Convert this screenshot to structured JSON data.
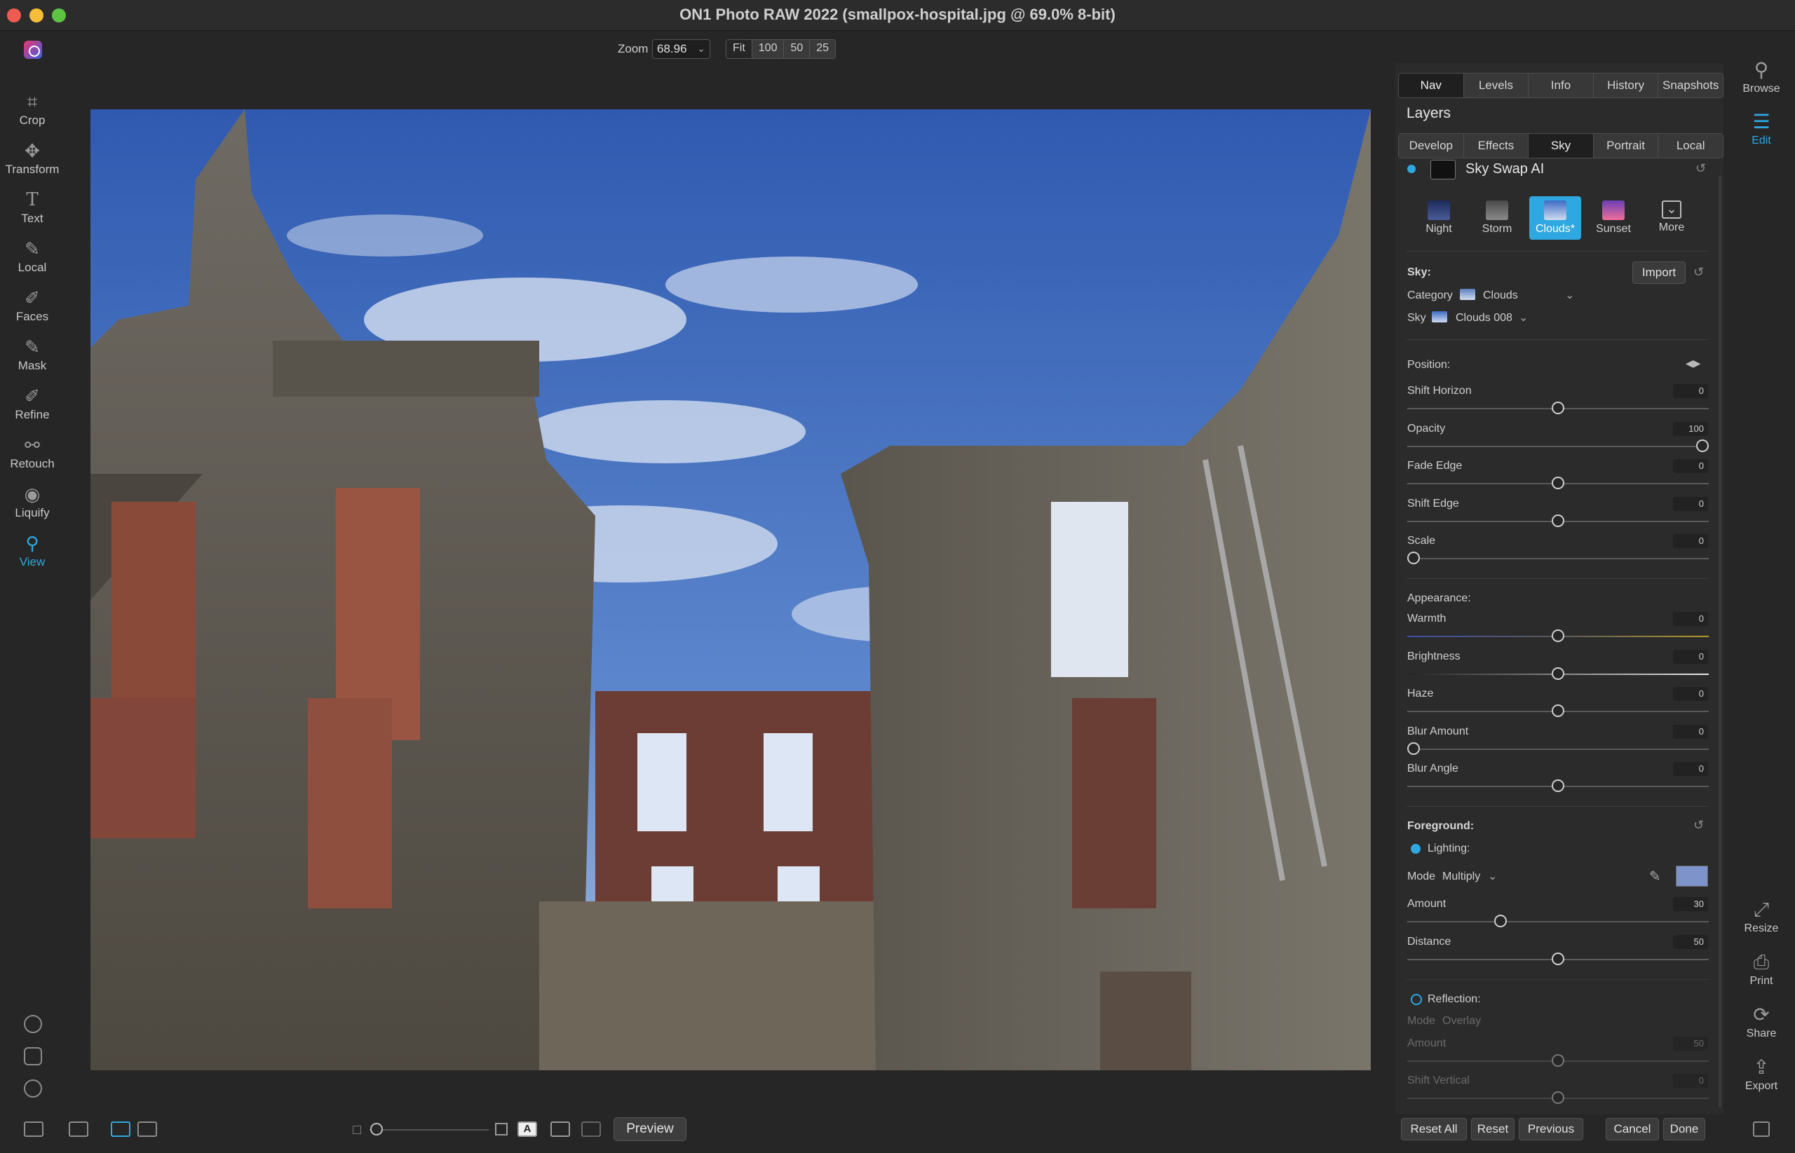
{
  "window": {
    "title": "ON1 Photo RAW 2022 (smallpox-hospital.jpg @ 69.0% 8-bit)"
  },
  "zoom": {
    "label": "Zoom",
    "value": "68.96",
    "presets": [
      "Fit",
      "100",
      "50",
      "25"
    ]
  },
  "left_tools": [
    {
      "label": "Crop",
      "icon": "crop-icon"
    },
    {
      "label": "Transform",
      "icon": "transform-icon"
    },
    {
      "label": "Text",
      "icon": "text-icon"
    },
    {
      "label": "Local",
      "icon": "local-brush-icon"
    },
    {
      "label": "Faces",
      "icon": "faces-icon"
    },
    {
      "label": "Mask",
      "icon": "mask-icon"
    },
    {
      "label": "Refine",
      "icon": "refine-icon"
    },
    {
      "label": "Retouch",
      "icon": "retouch-icon"
    },
    {
      "label": "Liquify",
      "icon": "liquify-icon"
    },
    {
      "label": "View",
      "icon": "view-icon",
      "active": true
    }
  ],
  "right_tools": {
    "browse": "Browse",
    "edit": "Edit",
    "resize": "Resize",
    "print": "Print",
    "share": "Share",
    "export": "Export"
  },
  "panel": {
    "top_tabs": [
      "Nav",
      "Levels",
      "Info",
      "History",
      "Snapshots"
    ],
    "active_top_tab": "Nav",
    "layers_title": "Layers",
    "module_tabs": [
      "Develop",
      "Effects",
      "Sky",
      "Portrait",
      "Local"
    ],
    "active_module_tab": "Sky",
    "filter_name": "Sky Swap AI",
    "sky_presets": [
      "Night",
      "Storm",
      "Clouds*",
      "Sunset",
      "More"
    ],
    "active_preset": "Clouds*",
    "sky_section": {
      "heading": "Sky:",
      "import_label": "Import",
      "category_label": "Category",
      "category_value": "Clouds",
      "sky_label": "Sky",
      "sky_value": "Clouds 008"
    },
    "position_section": {
      "heading": "Position:",
      "sliders": [
        {
          "label": "Shift Horizon",
          "value": "0",
          "level": 0.5
        },
        {
          "label": "Opacity",
          "value": "100",
          "level": 1.0
        },
        {
          "label": "Fade Edge",
          "value": "0",
          "level": 0.5
        },
        {
          "label": "Shift Edge",
          "value": "0",
          "level": 0.5
        },
        {
          "label": "Scale",
          "value": "0",
          "level": 0.0
        }
      ]
    },
    "appearance_section": {
      "heading": "Appearance:",
      "sliders": [
        {
          "label": "Warmth",
          "value": "0",
          "level": 0.5
        },
        {
          "label": "Brightness",
          "value": "0",
          "level": 0.5
        },
        {
          "label": "Haze",
          "value": "0",
          "level": 0.5
        },
        {
          "label": "Blur Amount",
          "value": "0",
          "level": 0.0
        },
        {
          "label": "Blur Angle",
          "value": "0",
          "level": 0.5
        }
      ]
    },
    "foreground_section": {
      "heading": "Foreground:",
      "lighting_label": "Lighting:",
      "mode_label": "Mode",
      "mode_value": "Multiply",
      "swatch_color": "#7d93c9",
      "sliders": [
        {
          "label": "Amount",
          "value": "30",
          "level": 0.3
        },
        {
          "label": "Distance",
          "value": "50",
          "level": 0.5
        }
      ],
      "reflection_label": "Reflection:",
      "reflection_mode_label": "Mode",
      "reflection_mode_value": "Overlay",
      "reflection_amount_label": "Amount",
      "reflection_amount_value": "50",
      "shift_vertical_label": "Shift Vertical",
      "shift_vertical_value": "0"
    },
    "footer_buttons": [
      "Reset All",
      "Reset",
      "Previous",
      "Cancel",
      "Done"
    ]
  },
  "bottom_bar": {
    "preview_label": "Preview",
    "a_glyph": "A"
  },
  "colors": {
    "accent": "#2fa7e0",
    "background": "#262626",
    "panel": "#2b2b2b"
  }
}
